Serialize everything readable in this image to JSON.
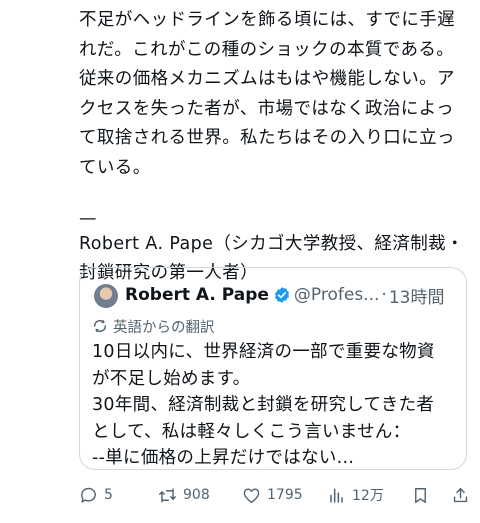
{
  "post": {
    "paragraph": "不足がヘッドラインを飾る頃には、すでに手遅\nれだ。これがこの種のショックの本質である。\n従来の価格メカニズムはもはや機能しない。ア\nクセスを失った者が、市場ではなく政治によっ\nて取捨される世界。私たちはその入り口に立っ\nている。",
    "dash": "—",
    "attribution": "Robert A. Pape（シカゴ大学教授、経済制裁・\n封鎖研究の第一人者）"
  },
  "quote": {
    "name": "Robert A. Pape",
    "handle": "@Profes...",
    "separator": "·",
    "time": "13時間",
    "translation_label": "英語からの翻訳",
    "text": "10日以内に、世界経済の一部で重要な物資\nが不足し始めます。\n30年間、経済制裁と封鎖を研究してきた者\nとして、私は軽々しくこう言いません：\n--単に価格の上昇だけではない..."
  },
  "actions": {
    "replies": "5",
    "reposts": "908",
    "likes": "1795",
    "views": "12万"
  },
  "colors": {
    "text": "#0f1419",
    "secondary": "#536471",
    "border": "#cfd9de",
    "verified": "#1d9bf0"
  },
  "icons": [
    "reply-icon",
    "repost-icon",
    "like-icon",
    "views-icon",
    "bookmark-icon",
    "share-icon",
    "verified-icon",
    "translate-icon"
  ]
}
